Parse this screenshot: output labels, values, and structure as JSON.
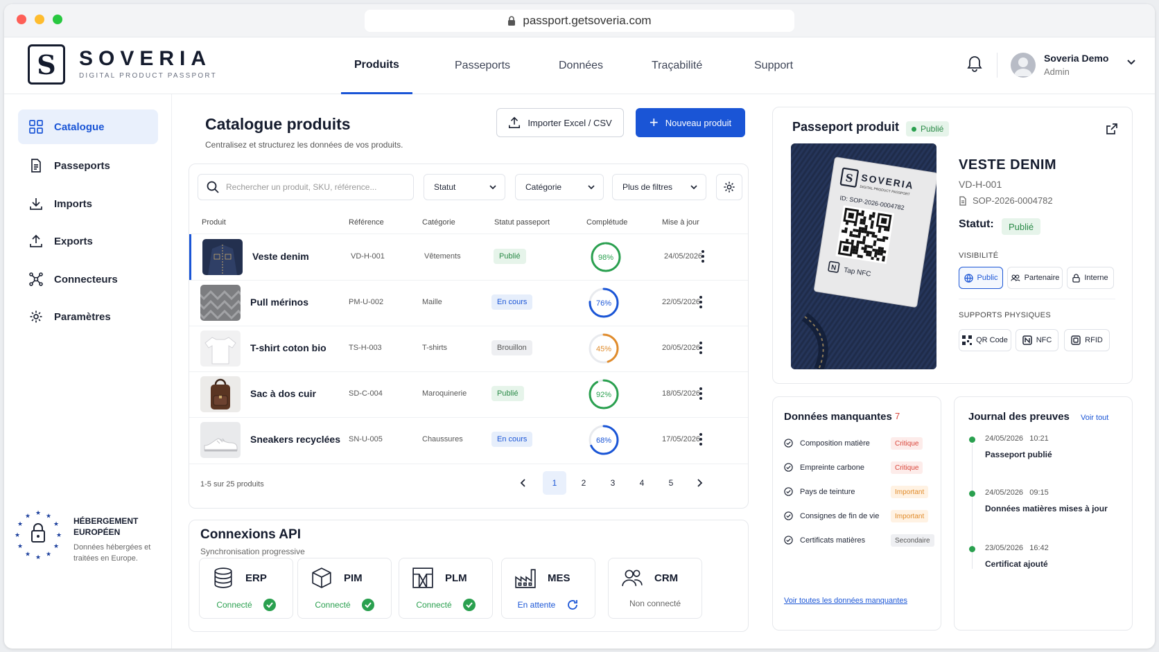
{
  "browser": {
    "url": "passport.getsoveria.com"
  },
  "brand": {
    "name": "SOVERIA",
    "tagline": "DIGITAL PRODUCT PASSPORT",
    "mark": "S"
  },
  "nav": {
    "tabs": [
      {
        "label": "Produits",
        "active": true
      },
      {
        "label": "Passeports"
      },
      {
        "label": "Données"
      },
      {
        "label": "Traçabilité"
      },
      {
        "label": "Support"
      }
    ]
  },
  "user": {
    "name": "Soveria Demo",
    "role": "Admin"
  },
  "sidebar": {
    "items": [
      {
        "label": "Catalogue",
        "icon": "grid-icon",
        "active": true
      },
      {
        "label": "Passeports",
        "icon": "document-icon"
      },
      {
        "label": "Imports",
        "icon": "download-icon"
      },
      {
        "label": "Exports",
        "icon": "upload-icon"
      },
      {
        "label": "Connecteurs",
        "icon": "network-icon"
      },
      {
        "label": "Paramètres",
        "icon": "gear-icon"
      }
    ]
  },
  "hosting": {
    "title": "HÉBERGEMENT EUROPÉEN",
    "desc": "Données hébergées et traitées en Europe."
  },
  "catalog": {
    "title": "Catalogue produits",
    "subtitle": "Centralisez et structurez les données de vos produits.",
    "import_label": "Importer Excel / CSV",
    "new_label": "Nouveau produit",
    "search_placeholder": "Rechercher un produit, SKU, référence...",
    "filters": [
      "Statut",
      "Catégorie",
      "Plus de filtres"
    ],
    "columns": [
      "Produit",
      "Référence",
      "Catégorie",
      "Statut passeport",
      "Complétude",
      "Mise à jour"
    ],
    "rows": [
      {
        "name": "Veste denim",
        "ref": "VD-H-001",
        "cat": "Vêtements",
        "status": "Publié",
        "status_type": "pub",
        "completion": 98,
        "completion_label": "98%",
        "date": "24/05/2026",
        "thumb": "denim"
      },
      {
        "name": "Pull mérinos",
        "ref": "PM-U-002",
        "cat": "Maille",
        "status": "En cours",
        "status_type": "cours",
        "completion": 76,
        "completion_label": "76%",
        "date": "22/05/2026",
        "thumb": "knit"
      },
      {
        "name": "T-shirt coton bio",
        "ref": "TS-H-003",
        "cat": "T-shirts",
        "status": "Brouillon",
        "status_type": "draft",
        "completion": 45,
        "completion_label": "45%",
        "date": "20/05/2026",
        "thumb": "tshirt"
      },
      {
        "name": "Sac à dos cuir",
        "ref": "SD-C-004",
        "cat": "Maroquinerie",
        "status": "Publié",
        "status_type": "pub",
        "completion": 92,
        "completion_label": "92%",
        "date": "18/05/2026",
        "thumb": "bag"
      },
      {
        "name": "Sneakers recyclées",
        "ref": "SN-U-005",
        "cat": "Chaussures",
        "status": "En cours",
        "status_type": "cours",
        "completion": 68,
        "completion_label": "68%",
        "date": "17/05/2026",
        "thumb": "shoe"
      }
    ],
    "footer": "1-5 sur 25 produits",
    "pages": [
      "1",
      "2",
      "3",
      "4",
      "5"
    ],
    "current_page": "1"
  },
  "api": {
    "title": "Connexions API",
    "subtitle": "Synchronisation progressive",
    "items": [
      {
        "name": "ERP",
        "status": "Connecté",
        "state": "ok",
        "icon": "database-icon"
      },
      {
        "name": "PIM",
        "status": "Connecté",
        "state": "ok",
        "icon": "cube-icon"
      },
      {
        "name": "PLM",
        "status": "Connecté",
        "state": "ok",
        "icon": "blueprint-icon"
      },
      {
        "name": "MES",
        "status": "En attente",
        "state": "wait",
        "icon": "factory-icon"
      },
      {
        "name": "CRM",
        "status": "Non connecté",
        "state": "off",
        "icon": "users-icon"
      }
    ]
  },
  "passport": {
    "title": "Passeport produit",
    "badge": "Publié",
    "product": "VESTE DENIM",
    "sku": "VD-H-001",
    "id": "SOP-2026-0004782",
    "status_label": "Statut:",
    "status": "Publié",
    "label_brand": "SOVERIA",
    "label_tag": "DIGITAL PRODUCT PASSPORT",
    "label_id": "ID: SOP-2026-0004782",
    "label_nfc": "Tap NFC",
    "visibility_label": "VISIBILITÉ",
    "visibility": [
      "Public",
      "Partenaire",
      "Interne"
    ],
    "supports_label": "SUPPORTS PHYSIQUES",
    "supports": [
      "QR Code",
      "NFC",
      "RFID"
    ]
  },
  "missing": {
    "title": "Données manquantes",
    "count": "7",
    "items": [
      {
        "label": "Composition matière",
        "tag": "Critique",
        "type": "crit"
      },
      {
        "label": "Empreinte carbone",
        "tag": "Critique",
        "type": "crit"
      },
      {
        "label": "Pays de teinture",
        "tag": "Important",
        "type": "imp"
      },
      {
        "label": "Consignes de fin de vie",
        "tag": "Important",
        "type": "imp"
      },
      {
        "label": "Certificats matières",
        "tag": "Secondaire",
        "type": "sec"
      }
    ],
    "link": "Voir toutes les données manquantes"
  },
  "journal": {
    "title": "Journal des preuves",
    "link": "Voir tout",
    "items": [
      {
        "date": "24/05/2026",
        "time": "10:21",
        "text": "Passeport publié"
      },
      {
        "date": "24/05/2026",
        "time": "09:15",
        "text": "Données matières mises à jour"
      },
      {
        "date": "23/05/2026",
        "time": "16:42",
        "text": "Certificat ajouté"
      }
    ]
  },
  "colors": {
    "accent": "#1a55d6",
    "success": "#2aa04f",
    "warning": "#e08b2b",
    "danger": "#d9453a"
  }
}
